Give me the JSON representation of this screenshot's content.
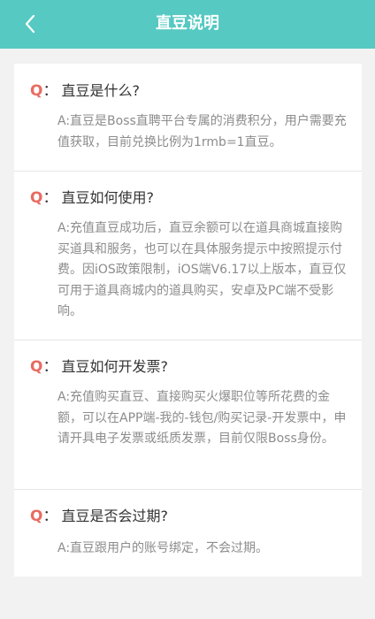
{
  "header": {
    "title": "直豆说明",
    "back_icon": "chevron-left-icon",
    "background": "#56c9c2"
  },
  "faq": [
    {
      "q_mark": "Q",
      "q_colon": "：",
      "question": "直豆是什么?",
      "answer": "A:直豆是Boss直聘平台专属的消费积分，用户需要充值获取，目前兑换比例为1rmb=1直豆。"
    },
    {
      "q_mark": "Q",
      "q_colon": "：",
      "question": "直豆如何使用?",
      "answer": "A:充值直豆成功后，直豆余额可以在道具商城直接购买道具和服务，也可以在具体服务提示中按照提示付费。因iOS政策限制，iOS端V6.17以上版本，直豆仅可用于道具商城内的道具购买，安卓及PC端不受影响。"
    },
    {
      "q_mark": "Q",
      "q_colon": "：",
      "question": "直豆如何开发票?",
      "answer": "A:充值购买直豆、直接购买火爆职位等所花费的金额，可以在APP端-我的-钱包/购买记录-开发票中，申请开具电子发票或纸质发票，目前仅限Boss身份。"
    },
    {
      "q_mark": "Q",
      "q_colon": "：",
      "question": "直豆是否会过期?",
      "answer": "A:直豆跟用户的账号绑定，不会过期。"
    }
  ],
  "colors": {
    "q_mark": "#e86b62",
    "question": "#333333",
    "answer": "#8c8c8c",
    "page_bg": "#f2f2f2"
  }
}
